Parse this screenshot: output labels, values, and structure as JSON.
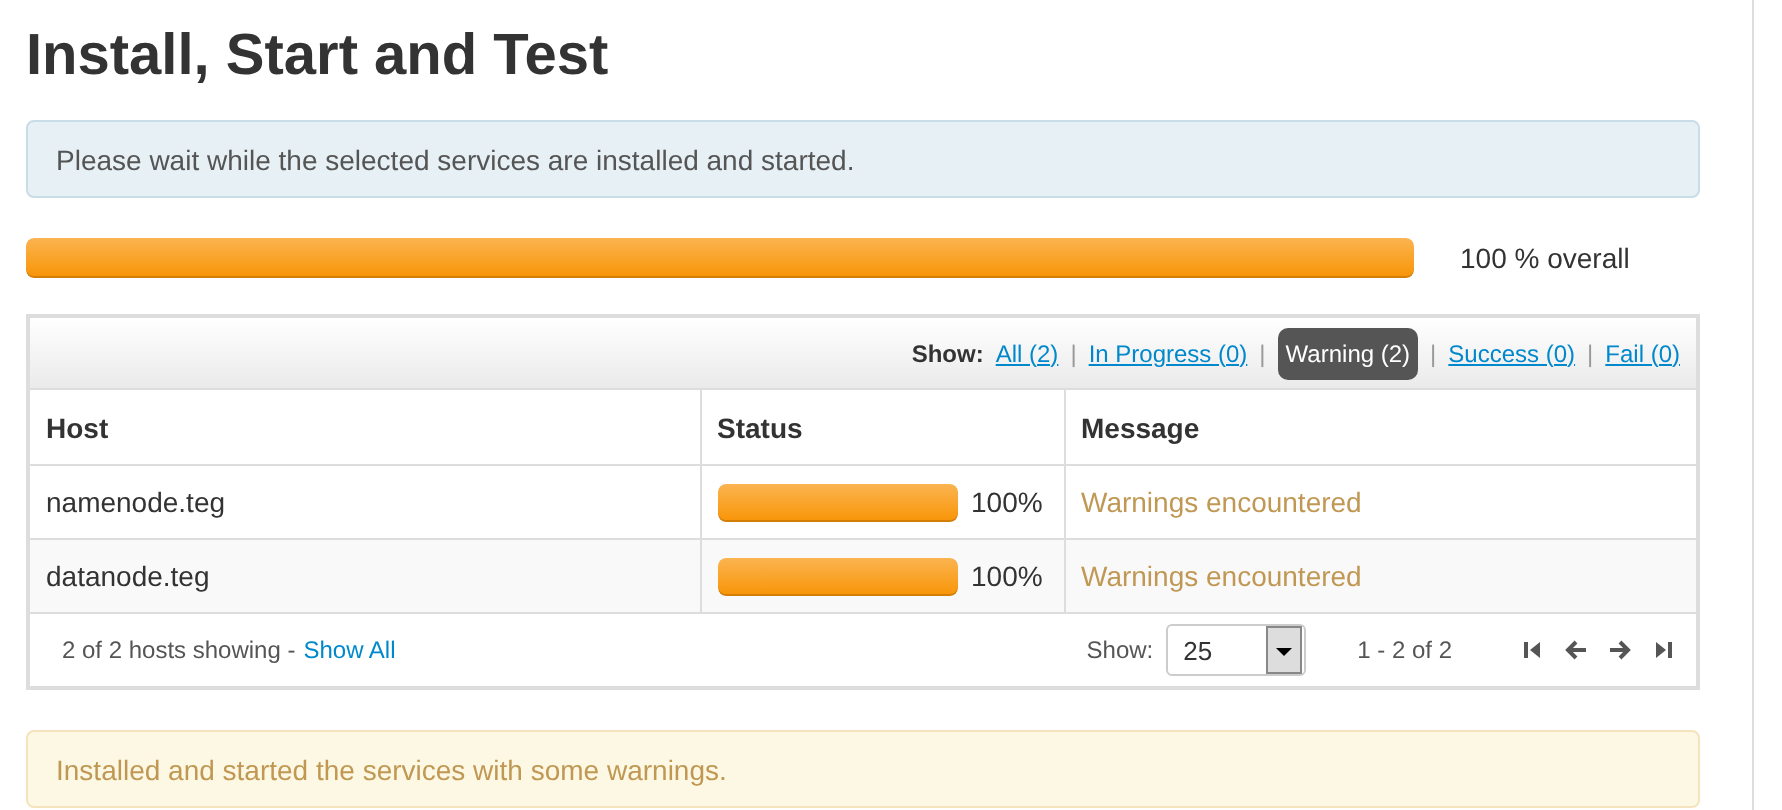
{
  "title": "Install, Start and Test",
  "info_alert": "Please wait while the selected services are installed and started.",
  "overall": {
    "level": 1.0,
    "label": "100 % overall"
  },
  "filter": {
    "label": "Show:",
    "separator": "|",
    "options": [
      {
        "label": "All (2)",
        "selected": false
      },
      {
        "label": "In Progress (0)",
        "selected": false
      },
      {
        "label": "Warning (2)",
        "selected": true
      },
      {
        "label": "Success (0)",
        "selected": false
      },
      {
        "label": "Fail (0)",
        "selected": false
      }
    ]
  },
  "table": {
    "columns": [
      "Host",
      "Status",
      "Message"
    ],
    "rows": [
      {
        "host": "namenode.teg",
        "level": 1.0,
        "percent": "100%",
        "message": "Warnings encountered"
      },
      {
        "host": "datanode.teg",
        "level": 1.0,
        "percent": "100%",
        "message": "Warnings encountered"
      }
    ]
  },
  "footer": {
    "summary": "2 of 2 hosts showing -",
    "show_all": "Show All",
    "show_label": "Show:",
    "page_size": "25",
    "range": "1 - 2 of 2"
  },
  "result_alert": "Installed and started the services with some warnings."
}
